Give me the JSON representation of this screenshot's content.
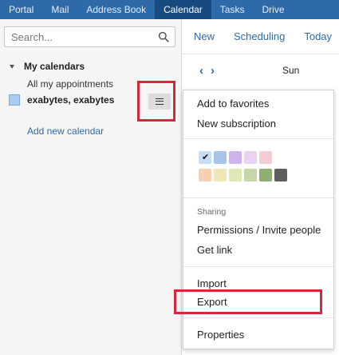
{
  "topnav": {
    "items": [
      "Portal",
      "Mail",
      "Address Book",
      "Calendar",
      "Tasks",
      "Drive"
    ],
    "active": "Calendar"
  },
  "sidebar": {
    "search": {
      "placeholder": "Search...",
      "icon": "magnifier"
    },
    "section_title": "My calendars",
    "all_appointments": "All my appointments",
    "calendar": {
      "name": "exabytes, exabytes",
      "color": "#a9cdf2"
    },
    "add_calendar": "Add new calendar"
  },
  "toolbar": {
    "new": "New",
    "scheduling": "Scheduling",
    "today": "Today"
  },
  "datenav": {
    "day": "Sun"
  },
  "dropdown": {
    "add_to_favorites": "Add to favorites",
    "new_subscription": "New subscription",
    "colors": [
      "#c5def5",
      "#a6c4ec",
      "#cdb4ec",
      "#ead2f0",
      "#f2cdd3",
      "#f8cfb2",
      "#f1e6b5",
      "#dfe9b6",
      "#c7d6a8",
      "#8fae74",
      "#5f5f5f"
    ],
    "selected_color": "#c5def5",
    "sharing_label": "Sharing",
    "permissions": "Permissions / Invite people",
    "get_link": "Get link",
    "import": "Import",
    "export": "Export",
    "properties": "Properties"
  },
  "accent": "#2f6aa8",
  "highlight": "#d9263a"
}
